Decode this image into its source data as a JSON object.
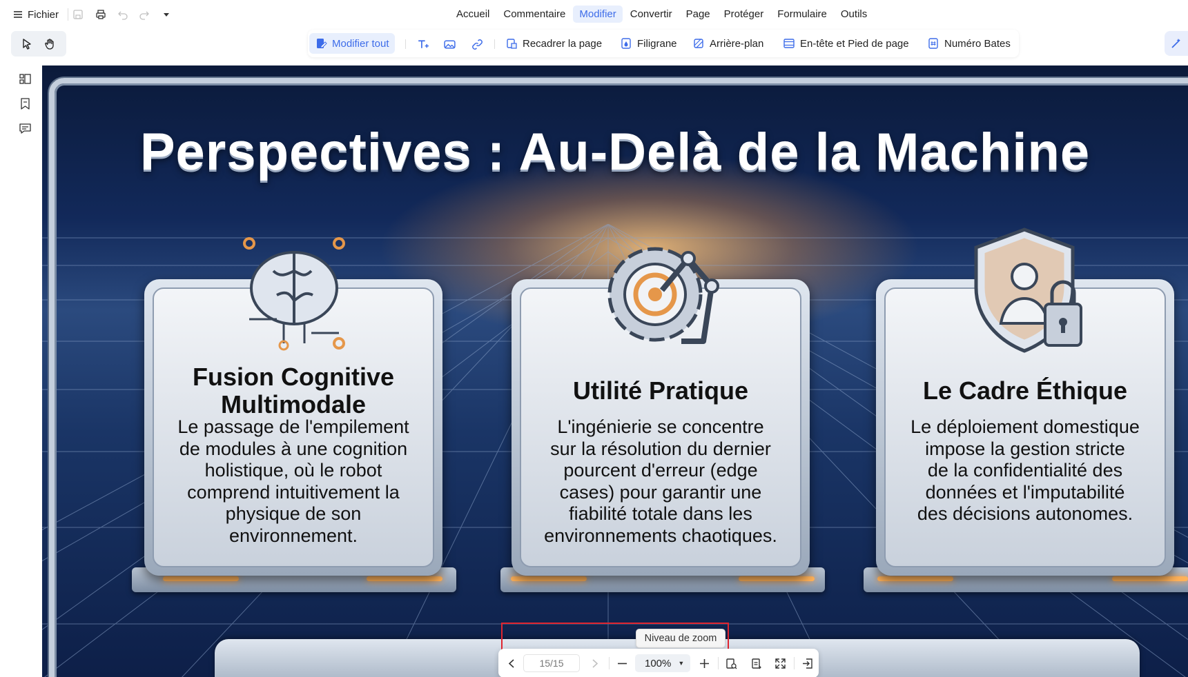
{
  "menubar": {
    "file_label": "Fichier",
    "tabs": [
      {
        "label": "Accueil",
        "active": false
      },
      {
        "label": "Commentaire",
        "active": false
      },
      {
        "label": "Modifier",
        "active": true
      },
      {
        "label": "Convertir",
        "active": false
      },
      {
        "label": "Page",
        "active": false
      },
      {
        "label": "Protéger",
        "active": false
      },
      {
        "label": "Formulaire",
        "active": false
      },
      {
        "label": "Outils",
        "active": false
      }
    ],
    "quick_actions": [
      "save-icon",
      "print-icon",
      "undo-icon",
      "redo-icon",
      "dropdown-icon"
    ]
  },
  "toolbar": {
    "edit_all": "Modifier tout",
    "crop_page": "Recadrer la page",
    "watermark": "Filigrane",
    "background": "Arrière-plan",
    "header_footer": "En-tête et Pied de page",
    "bates_number": "Numéro Bates"
  },
  "colors": {
    "accent": "#3d6ce9",
    "accent_bg": "#e8effd",
    "highlight": "#e0252f",
    "slide_background": "#12295a",
    "slide_glow": "#ffb25a"
  },
  "slide": {
    "title": "Perspectives : Au-Delà de la Machine",
    "cards": [
      {
        "title_lines": [
          "Fusion Cognitive",
          "Multimodale"
        ],
        "text_lines": [
          "Le passage de l'empilement",
          "de modules à une cognition",
          "holistique, où le robot",
          "comprend intuitivement la",
          "physique de son",
          "environnement."
        ],
        "icon": "brain-circuit-icon"
      },
      {
        "title_lines": [
          "Utilité Pratique"
        ],
        "text_lines": [
          "L'ingénierie se concentre",
          "sur la résolution du dernier",
          "pourcent d'erreur (edge",
          "cases) pour garantir une",
          "fiabilité totale dans les",
          "environnements chaotiques."
        ],
        "icon": "gear-target-robot-arm-icon"
      },
      {
        "title_lines": [
          "Le Cadre Éthique"
        ],
        "text_lines": [
          "Le déploiement domestique",
          "impose la gestion stricte",
          "de la confidentialité des",
          "données et l'imputabilité",
          "des décisions autonomes."
        ],
        "icon": "shield-user-lock-icon"
      }
    ]
  },
  "zoombar": {
    "page_value": "15/15",
    "zoom_level": "100%",
    "tooltip": "Niveau de zoom"
  }
}
